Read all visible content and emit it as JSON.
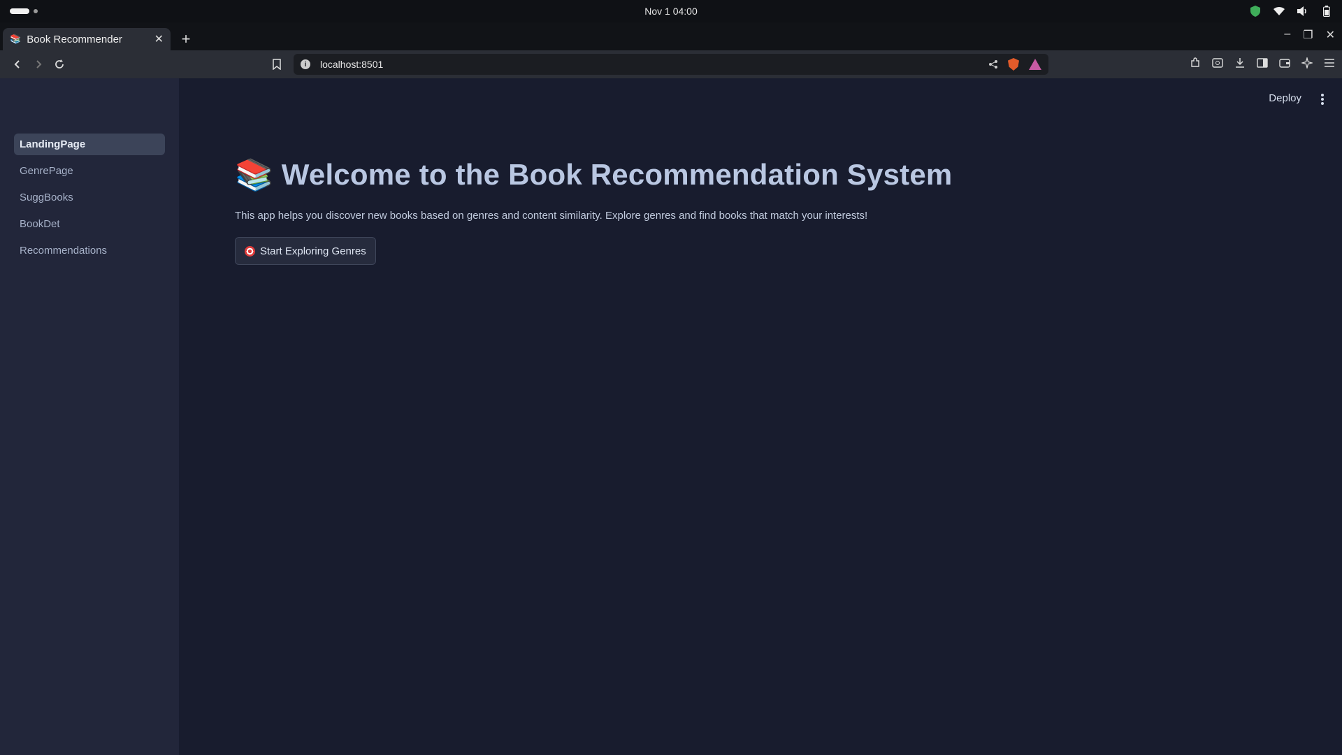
{
  "os": {
    "clock": "Nov 1  04:00"
  },
  "browser": {
    "tab_title": "Book Recommender",
    "tab_favicon": "📚",
    "url": "localhost:8501"
  },
  "sidebar": {
    "items": [
      {
        "label": "LandingPage",
        "active": true
      },
      {
        "label": "GenrePage"
      },
      {
        "label": "SuggBooks"
      },
      {
        "label": "BookDet"
      },
      {
        "label": "Recommendations"
      }
    ]
  },
  "header": {
    "deploy_label": "Deploy"
  },
  "main": {
    "title_emoji": "📚",
    "title": "Welcome to the Book Recommendation System",
    "description": "This app helps you discover new books based on genres and content similarity. Explore genres and find books that match your interests!",
    "cta_label": "Start Exploring Genres"
  },
  "colors": {
    "background": "#181c2e",
    "sidebar": "#22263a",
    "title": "#b9c7e2",
    "active_nav": "#3c4459"
  },
  "icons": [
    "search-icon",
    "bookmark-icon",
    "share-icon",
    "brave-shields-icon",
    "brave-rewards-icon",
    "extensions-icon",
    "download-icon",
    "sidebar-icon",
    "wallet-icon",
    "leo-icon",
    "menu-icon",
    "target-icon"
  ]
}
